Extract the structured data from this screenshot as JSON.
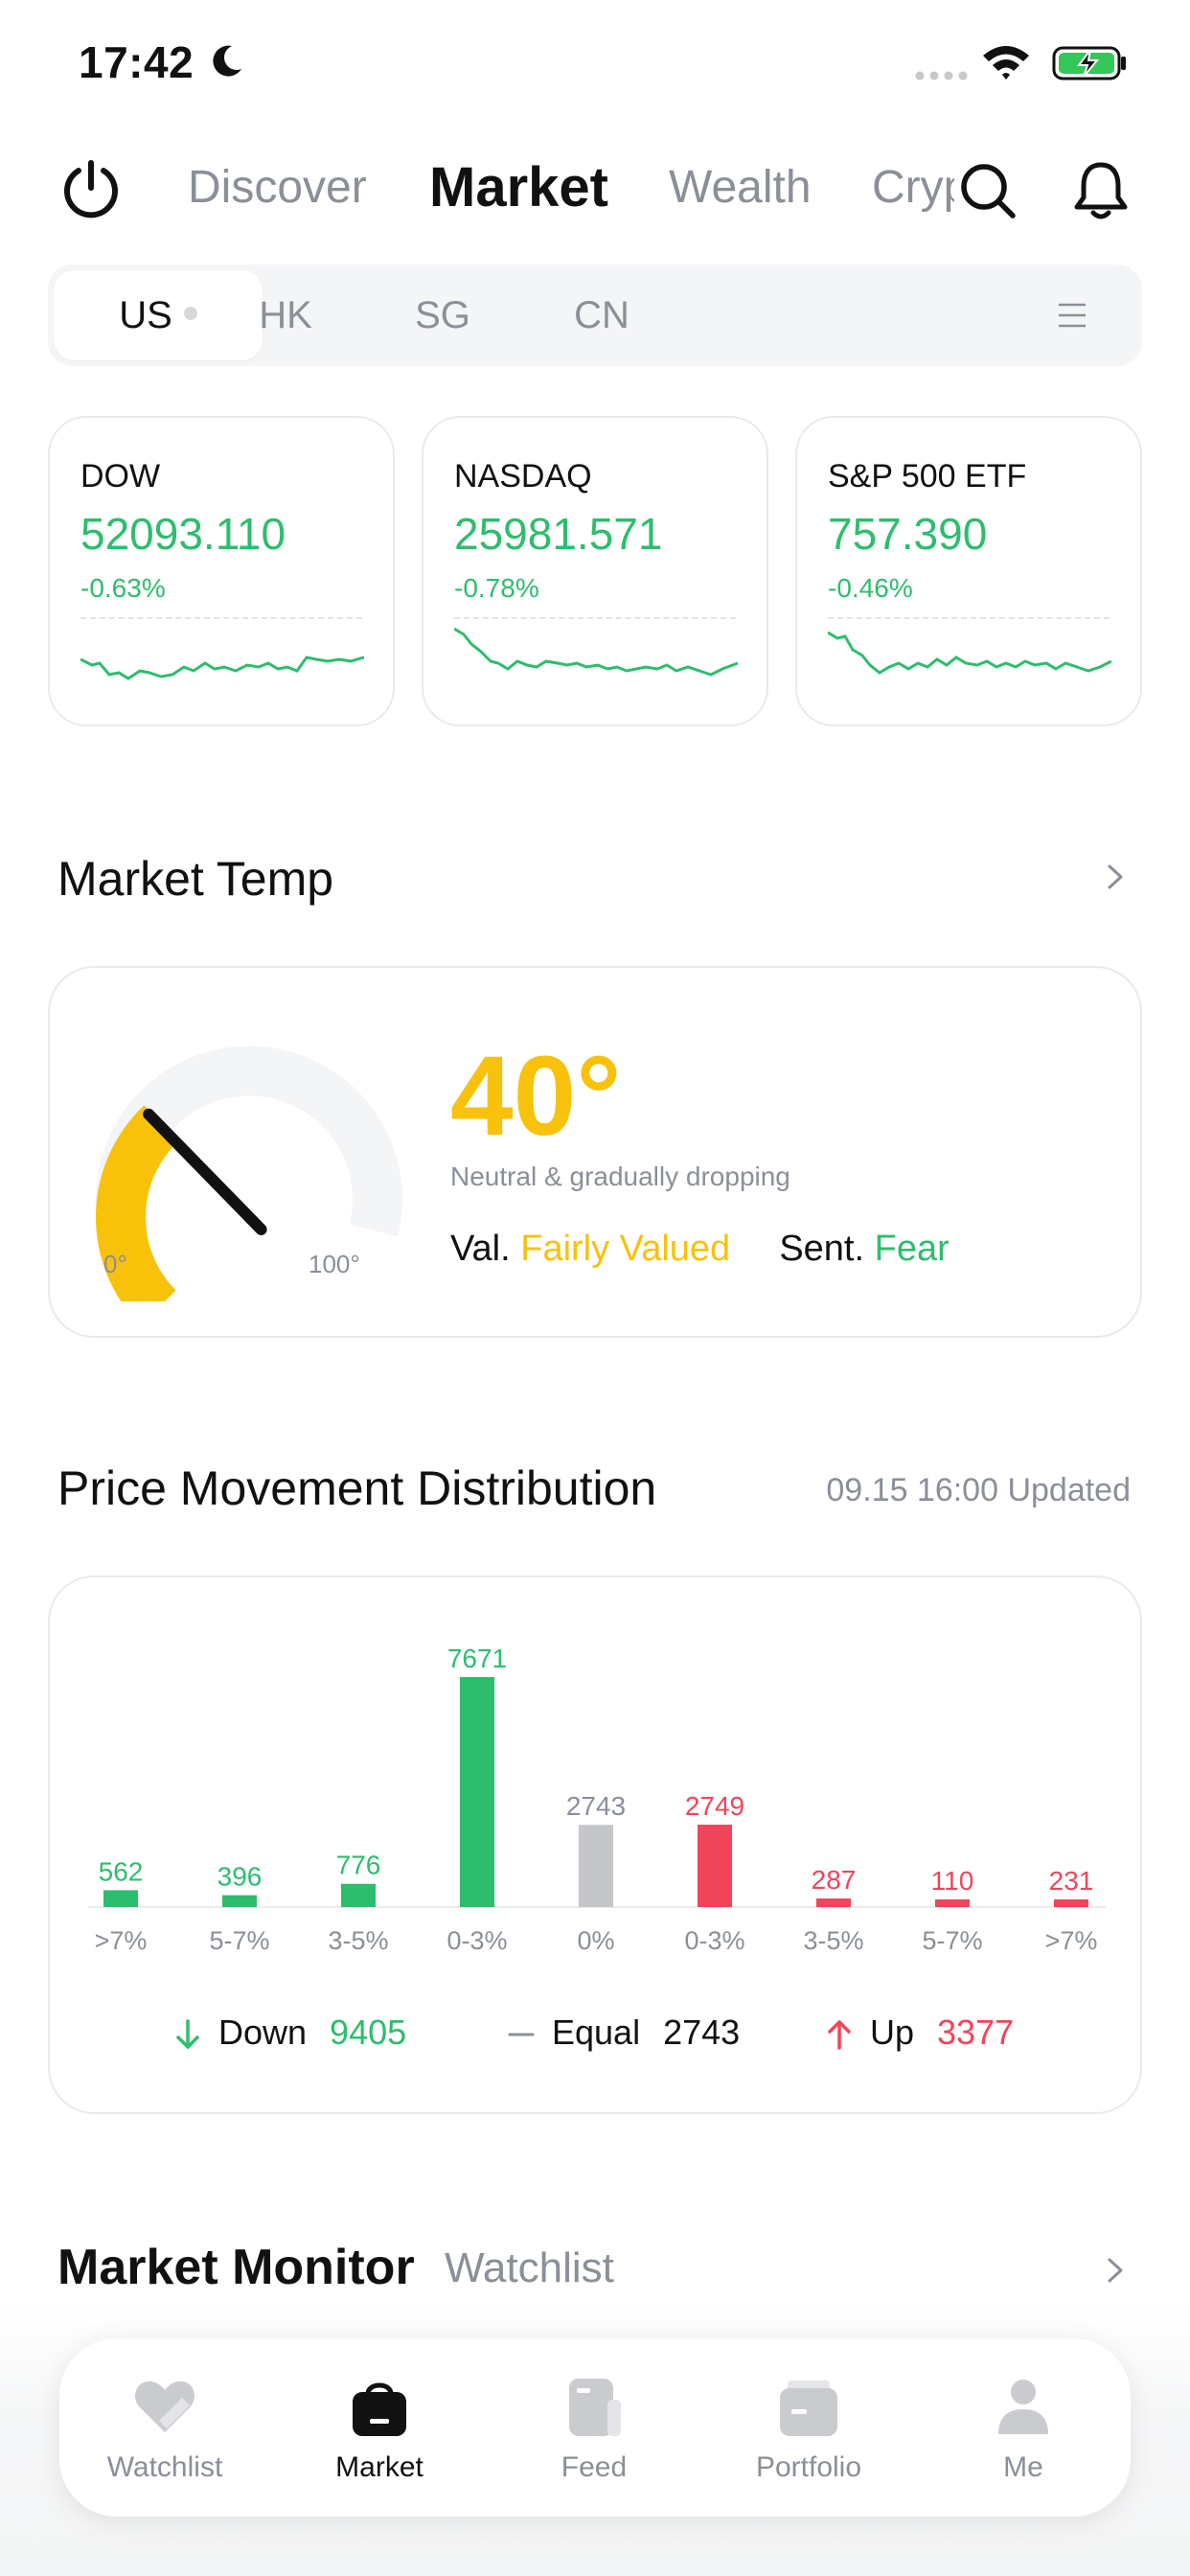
{
  "status_bar": {
    "time": "17:42",
    "icons": [
      "moon-icon",
      "signal-dots-icon",
      "wifi-icon",
      "battery-charging-icon"
    ]
  },
  "top_nav": {
    "tabs": [
      {
        "label": "Discover"
      },
      {
        "label": "Market",
        "active": true
      },
      {
        "label": "Wealth"
      },
      {
        "label": "Crypto"
      }
    ],
    "icons": [
      "power-icon",
      "search-icon",
      "bell-icon"
    ]
  },
  "market_segments": {
    "items": [
      {
        "label": "US",
        "active": true
      },
      {
        "label": "HK"
      },
      {
        "label": "SG"
      },
      {
        "label": "CN"
      }
    ],
    "menu_icon": "menu-icon"
  },
  "indices": [
    {
      "name": "DOW",
      "value": "52093.110",
      "change": "-0.63%"
    },
    {
      "name": "NASDAQ",
      "value": "25981.571",
      "change": "-0.78%"
    },
    {
      "name": "S&P 500 ETF",
      "value": "757.390",
      "change": "-0.46%"
    }
  ],
  "market_temp": {
    "title": "Market Temp",
    "value": "40°",
    "gauge_level": 40,
    "description": "Neutral & gradually dropping",
    "gauge_min": "0°",
    "gauge_max": "100°",
    "valuation_label": "Val.",
    "valuation_value": "Fairly Valued",
    "sentiment_label": "Sent.",
    "sentiment_value": "Fear"
  },
  "distribution": {
    "title": "Price Movement Distribution",
    "updated": "09.15 16:00 Updated",
    "summary": {
      "down_label": "Down",
      "down_value": "9405",
      "equal_label": "Equal",
      "equal_value": "2743",
      "up_label": "Up",
      "up_value": "3377"
    }
  },
  "chart_data": {
    "type": "bar",
    "categories": [
      ">7%",
      "5-7%",
      "3-5%",
      "0-3%",
      "0%",
      "0-3%",
      "3-5%",
      "5-7%",
      ">7%"
    ],
    "values": [
      562,
      396,
      776,
      7671,
      2743,
      2749,
      287,
      110,
      231
    ],
    "groups": [
      "down",
      "down",
      "down",
      "down",
      "equal",
      "up",
      "up",
      "up",
      "up"
    ],
    "colors": {
      "down": "#2dbd6e",
      "equal": "#c4c6ca",
      "up": "#f0455a"
    }
  },
  "market_monitor": {
    "title": "Market Monitor",
    "subtitle": "Watchlist"
  },
  "tab_bar": {
    "items": [
      {
        "label": "Watchlist",
        "icon": "watchlist-icon"
      },
      {
        "label": "Market",
        "icon": "market-bag-icon",
        "active": true
      },
      {
        "label": "Feed",
        "icon": "feed-icon"
      },
      {
        "label": "Portfolio",
        "icon": "portfolio-wallet-icon"
      },
      {
        "label": "Me",
        "icon": "profile-icon"
      }
    ]
  },
  "colors": {
    "green": "#2dbd6e",
    "red": "#f0455a",
    "yellow": "#f8c20a",
    "gray_text": "#8a8f98"
  }
}
